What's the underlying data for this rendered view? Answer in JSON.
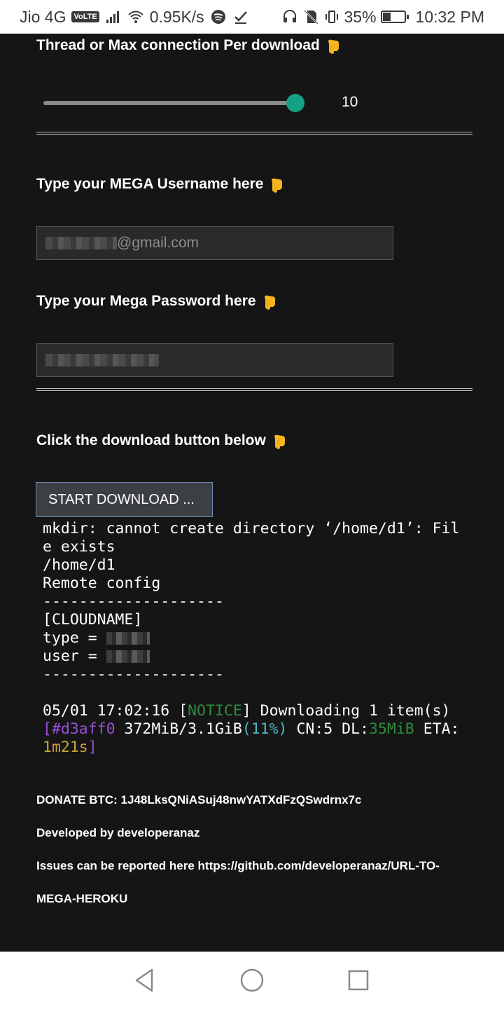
{
  "status_bar": {
    "carrier": "Jio 4G",
    "volte": "VoLTE",
    "speed": "0.95K/s",
    "battery_pct": "35%",
    "battery_level": 0.35,
    "time": "10:32 PM",
    "icons": [
      "signal-icon",
      "wifi-icon",
      "spotify-icon",
      "checkmark-icon",
      "headset-icon",
      "no-sim-icon",
      "vibrate-icon",
      "battery-icon"
    ]
  },
  "form": {
    "threads_heading": "Thread or Max connection Per download",
    "slider_value": "10",
    "slider_level": 1.0,
    "username_heading": "Type your MEGA Username here",
    "username_value": "@gmail.com",
    "password_heading": "Type your Mega Password here",
    "download_heading": "Click the download button below",
    "download_button": "START DOWNLOAD ..."
  },
  "console": {
    "line1": "mkdir: cannot create directory ‘/home/d1’: Fil",
    "line2": "e exists",
    "line3": "/home/d1",
    "line4": "Remote config",
    "sep": "--------------------",
    "line6": "[CLOUDNAME]",
    "type_label": "type = ",
    "user_label": "user = ",
    "log_time": "05/01 17:02:16 [",
    "notice": "NOTICE",
    "log_msg": "] Downloading 1 item(s)",
    "progress_open": "[",
    "progress_id": "#d3aff0",
    "progress_size": " 372MiB/3.1GiB",
    "progress_pct": "(11%)",
    "progress_cn": " CN:5 DL:",
    "progress_dl": "35MiB",
    "progress_eta": " ETA:",
    "progress_eta_val": "1m21s",
    "progress_close": "]"
  },
  "footer": {
    "donate": "DONATE BTC: 1J48LksQNiASuj48nwYATXdFzQSwdrnx7c",
    "developer": "Developed by developeranaz",
    "issues_1": "Issues can be reported here https://github.com/developeranaz/URL-TO-",
    "issues_2": "MEGA-HEROKU"
  },
  "colors": {
    "slider_thumb": "#16a085",
    "notice": "#2e8b3b",
    "hash": "#9a4dd6",
    "percent": "#4bb7c9",
    "eta": "#c9a03a"
  }
}
